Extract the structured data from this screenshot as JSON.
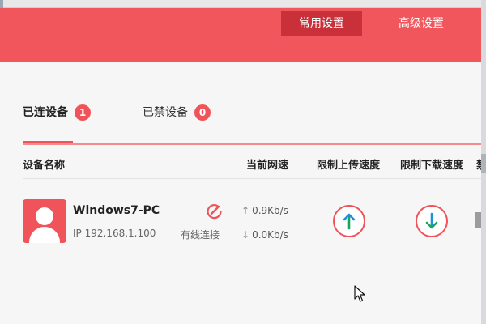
{
  "nav": {
    "tabs": [
      {
        "label": "常用设置",
        "active": true
      },
      {
        "label": "高级设置",
        "active": false
      }
    ]
  },
  "device_tabs": {
    "connected": {
      "label": "已连设备",
      "count": "1"
    },
    "blocked": {
      "label": "已禁设备",
      "count": "0"
    }
  },
  "table": {
    "headers": {
      "name": "设备名称",
      "speed": "当前网速",
      "upload_limit": "限制上传速度",
      "download_limit": "限制下载速度",
      "extra": "禁"
    }
  },
  "device": {
    "name": "Windows7-PC",
    "ip": "IP 192.168.1.100",
    "connection": "有线连接",
    "upload_speed": "0.9Kb/s",
    "download_speed": "0.0Kb/s",
    "icons": [
      "avatar-icon",
      "edit-icon",
      "upload-arrow-icon",
      "download-arrow-icon"
    ]
  },
  "colors": {
    "brand": "#f0565c",
    "active_tab": "#c9303a",
    "badge": "#f05359",
    "upload_arrow": "#19a55a",
    "download_arrow": "#1f8fe0"
  }
}
